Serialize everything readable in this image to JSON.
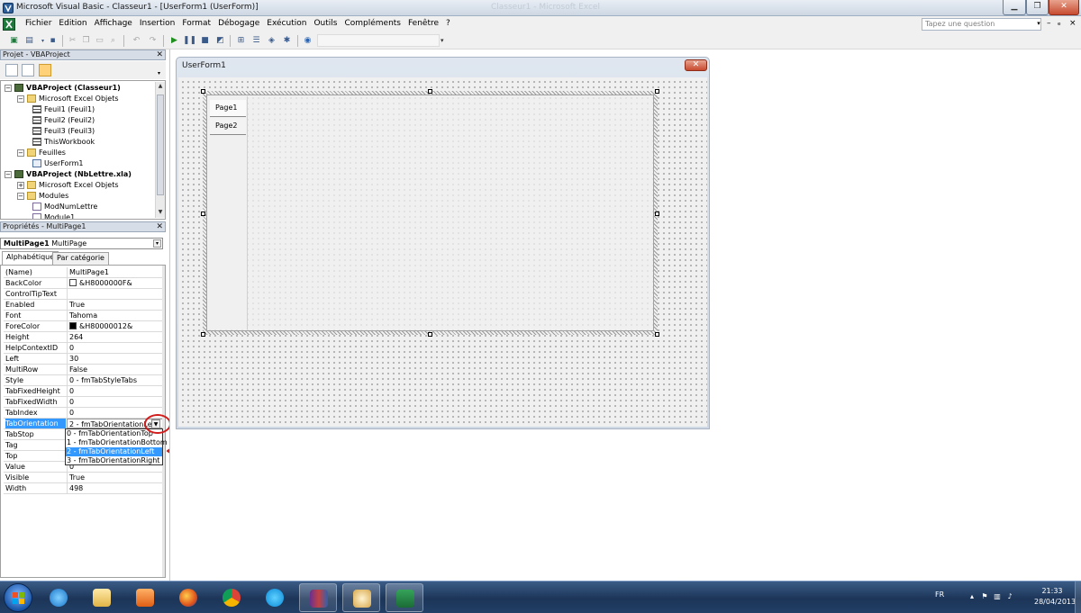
{
  "window": {
    "title": "Microsoft Visual Basic - Classeur1 - [UserForm1 (UserForm)]",
    "faint_title": "Classeur1 - Microsoft Excel",
    "min_label": "▁",
    "max_label": "❐",
    "close_label": "✕"
  },
  "menu": {
    "items": [
      "Fichier",
      "Edition",
      "Affichage",
      "Insertion",
      "Format",
      "Débogage",
      "Exécution",
      "Outils",
      "Compléments",
      "Fenêtre",
      "?"
    ],
    "ask_placeholder": "Tapez une question",
    "mdi_min": "–",
    "mdi_restore": "ₑ",
    "mdi_close": "×"
  },
  "project": {
    "title": "Projet - VBAProject",
    "close": "✕",
    "tree": [
      {
        "label": "VBAProject (Classeur1)",
        "bold": true,
        "icon": "vba",
        "expander": "−"
      },
      {
        "label": "Microsoft Excel Objets",
        "icon": "folder",
        "expander": "−"
      },
      {
        "label": "Feuil1 (Feuil1)",
        "icon": "sheet",
        "expander": ""
      },
      {
        "label": "Feuil2 (Feuil2)",
        "icon": "sheet",
        "expander": ""
      },
      {
        "label": "Feuil3 (Feuil3)",
        "icon": "sheet",
        "expander": ""
      },
      {
        "label": "ThisWorkbook",
        "icon": "sheet",
        "expander": ""
      },
      {
        "label": "Feuilles",
        "icon": "folder",
        "expander": "−"
      },
      {
        "label": "UserForm1",
        "icon": "form",
        "expander": ""
      },
      {
        "label": "VBAProject (NbLettre.xla)",
        "bold": true,
        "icon": "vba",
        "expander": "−"
      },
      {
        "label": "Microsoft Excel Objets",
        "icon": "folder",
        "expander": "+"
      },
      {
        "label": "Modules",
        "icon": "folder",
        "expander": "−"
      },
      {
        "label": "ModNumLettre",
        "icon": "module",
        "expander": ""
      },
      {
        "label": "Module1",
        "icon": "module",
        "expander": ""
      }
    ]
  },
  "properties": {
    "title": "Propriétés - MultiPage1",
    "close": "✕",
    "object_name": "MultiPage1",
    "object_type": "MultiPage",
    "tabs": [
      "Alphabétique",
      "Par catégorie"
    ],
    "rows": [
      {
        "name": "(Name)",
        "value": "MultiPage1"
      },
      {
        "name": "BackColor",
        "value": "&H8000000F&",
        "swatch": "#ffffff"
      },
      {
        "name": "ControlTipText",
        "value": ""
      },
      {
        "name": "Enabled",
        "value": "True"
      },
      {
        "name": "Font",
        "value": "Tahoma"
      },
      {
        "name": "ForeColor",
        "value": "&H80000012&",
        "swatch": "#000000"
      },
      {
        "name": "Height",
        "value": "264"
      },
      {
        "name": "HelpContextID",
        "value": "0"
      },
      {
        "name": "Left",
        "value": "30"
      },
      {
        "name": "MultiRow",
        "value": "False"
      },
      {
        "name": "Style",
        "value": "0 - fmTabStyleTabs"
      },
      {
        "name": "TabFixedHeight",
        "value": "0"
      },
      {
        "name": "TabFixedWidth",
        "value": "0"
      },
      {
        "name": "TabIndex",
        "value": "0"
      },
      {
        "name": "TabOrientation",
        "value": "2 - fmTabOrientationLeft",
        "selected": true
      },
      {
        "name": "TabStop",
        "value": ""
      },
      {
        "name": "Tag",
        "value": ""
      },
      {
        "name": "Top",
        "value": ""
      },
      {
        "name": "Value",
        "value": "0"
      },
      {
        "name": "Visible",
        "value": "True"
      },
      {
        "name": "Width",
        "value": "498"
      }
    ],
    "dropdown_options": [
      "0 - fmTabOrientationTop",
      "1 - fmTabOrientationBottom",
      "2 - fmTabOrientationLeft",
      "3 - fmTabOrientationRight"
    ],
    "dropdown_highlighted": 2
  },
  "form": {
    "title": "UserForm1",
    "close": "✕",
    "pages": [
      "Page1",
      "Page2"
    ]
  },
  "taskbar": {
    "apps": [
      "internet-explorer",
      "file-explorer",
      "media-player",
      "firefox",
      "chrome",
      "skype",
      "winrar",
      "paint",
      "excel"
    ],
    "language": "FR",
    "time": "21:33",
    "date": "28/04/2013"
  },
  "colors": {
    "selection": "#3399ff",
    "annotation": "#d11c1c"
  }
}
